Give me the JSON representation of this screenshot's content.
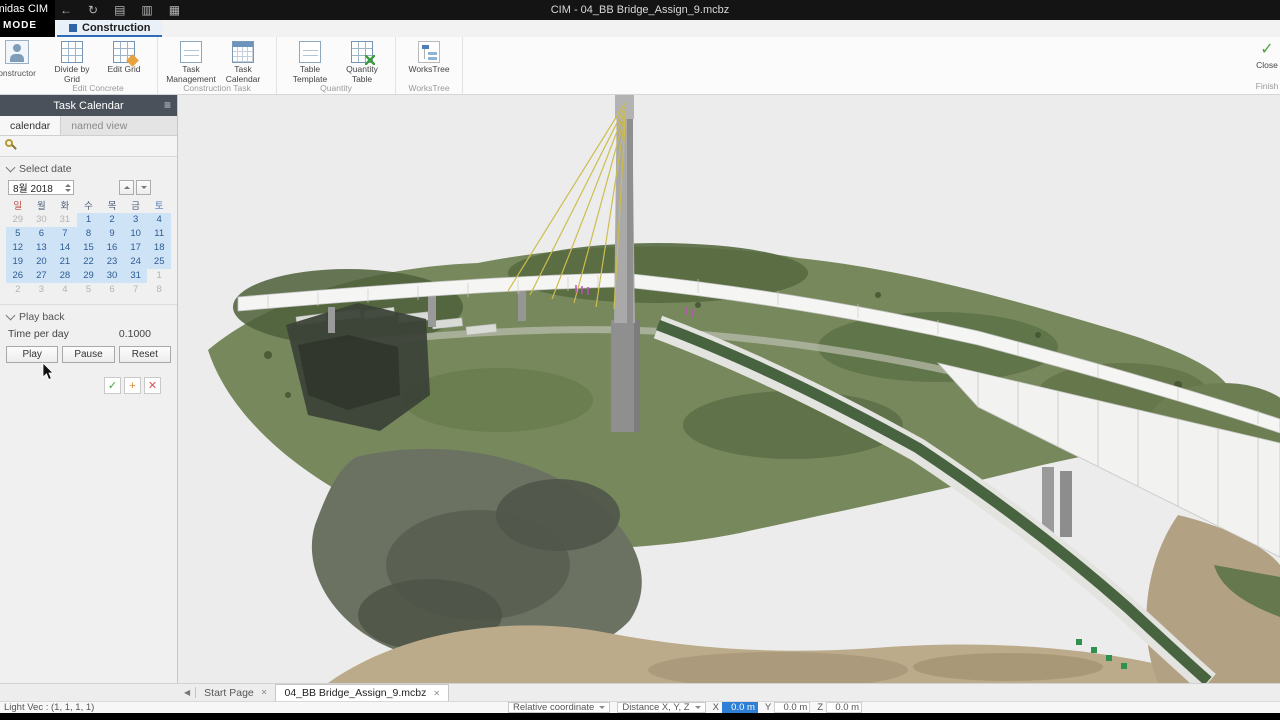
{
  "titlebar": {
    "title": "CIM - 04_BB Bridge_Assign_9.mcbz",
    "icons": [
      {
        "name": "back-icon",
        "glyph": "←"
      },
      {
        "name": "refresh-icon",
        "glyph": "↻"
      },
      {
        "name": "new-document-icon",
        "glyph": "▤"
      },
      {
        "name": "open-document-icon",
        "glyph": "▥"
      },
      {
        "name": "save-icon",
        "glyph": "▦"
      }
    ]
  },
  "brand": {
    "logo": "midas CIM",
    "mode": "MODE"
  },
  "ribbon": {
    "active_tab": "Construction",
    "constructor_label": "Constructor",
    "groups": [
      {
        "label": "Edit Concrete",
        "buttons": [
          {
            "label": "Divide by Grid"
          },
          {
            "label": "Edit Grid"
          }
        ]
      },
      {
        "label": "Construction Task",
        "buttons": [
          {
            "label": "Task Management"
          },
          {
            "label": "Task Calendar"
          }
        ]
      },
      {
        "label": "Quantity",
        "buttons": [
          {
            "label": "Table Template"
          },
          {
            "label": "Quantity Table"
          }
        ]
      },
      {
        "label": "WorksTree",
        "buttons": [
          {
            "label": "WorksTree"
          }
        ]
      }
    ],
    "close": {
      "label": "Close",
      "group": "Finish",
      "glyph": "✓"
    }
  },
  "panel": {
    "title": "Task Calendar",
    "menu_glyph": "≡",
    "tabs": [
      {
        "label": "calendar"
      },
      {
        "label": "named view"
      }
    ],
    "select_date": {
      "section": "Select date",
      "month": "8월 2018"
    },
    "calendar": {
      "weekdays": [
        "일",
        "월",
        "화",
        "수",
        "목",
        "금",
        "토"
      ],
      "rows": [
        {
          "cells": [
            {
              "n": "29",
              "s": "m"
            },
            {
              "n": "30",
              "s": "m"
            },
            {
              "n": "31",
              "s": "m"
            },
            {
              "n": "1",
              "s": "h"
            },
            {
              "n": "2",
              "s": "h"
            },
            {
              "n": "3",
              "s": "h"
            },
            {
              "n": "4",
              "s": "h"
            }
          ]
        },
        {
          "cells": [
            {
              "n": "5",
              "s": "h"
            },
            {
              "n": "6",
              "s": "h"
            },
            {
              "n": "7",
              "s": "h"
            },
            {
              "n": "8",
              "s": "h"
            },
            {
              "n": "9",
              "s": "h"
            },
            {
              "n": "10",
              "s": "h"
            },
            {
              "n": "11",
              "s": "h"
            }
          ]
        },
        {
          "cells": [
            {
              "n": "12",
              "s": "h"
            },
            {
              "n": "13",
              "s": "h"
            },
            {
              "n": "14",
              "s": "h"
            },
            {
              "n": "15",
              "s": "h"
            },
            {
              "n": "16",
              "s": "h"
            },
            {
              "n": "17",
              "s": "h"
            },
            {
              "n": "18",
              "s": "h"
            }
          ]
        },
        {
          "cells": [
            {
              "n": "19",
              "s": "h"
            },
            {
              "n": "20",
              "s": "h"
            },
            {
              "n": "21",
              "s": "h"
            },
            {
              "n": "22",
              "s": "h"
            },
            {
              "n": "23",
              "s": "h"
            },
            {
              "n": "24",
              "s": "h"
            },
            {
              "n": "25",
              "s": "h"
            }
          ]
        },
        {
          "cells": [
            {
              "n": "26",
              "s": "h"
            },
            {
              "n": "27",
              "s": "h"
            },
            {
              "n": "28",
              "s": "h"
            },
            {
              "n": "29",
              "s": "h"
            },
            {
              "n": "30",
              "s": "h"
            },
            {
              "n": "31",
              "s": "h"
            },
            {
              "n": "1",
              "s": "m"
            }
          ]
        },
        {
          "cells": [
            {
              "n": "2",
              "s": "m"
            },
            {
              "n": "3",
              "s": "m"
            },
            {
              "n": "4",
              "s": "m"
            },
            {
              "n": "5",
              "s": "m"
            },
            {
              "n": "6",
              "s": "m"
            },
            {
              "n": "7",
              "s": "m"
            },
            {
              "n": "8",
              "s": "m"
            }
          ]
        }
      ]
    },
    "playback": {
      "section": "Play back",
      "time_label": "Time per day",
      "time_value": "0.1000",
      "buttons": [
        "Play",
        "Pause",
        "Reset"
      ]
    },
    "actions": [
      {
        "name": "confirm-button",
        "glyph": "✓",
        "kind": "confirm"
      },
      {
        "name": "add-button",
        "glyph": "+",
        "kind": "add"
      },
      {
        "name": "delete-button",
        "glyph": "✕",
        "kind": "del"
      }
    ]
  },
  "doctabs": {
    "close_glyph": "✕",
    "tabs": [
      {
        "label": "Start Page",
        "active": false
      },
      {
        "label": "04_BB Bridge_Assign_9.mcbz",
        "active": true
      }
    ]
  },
  "statusbar": {
    "light_vec": "Light Vec : (1, 1, 1, 1)",
    "coordinate_dropdown": "Relative coordinate",
    "distance_dropdown": "Distance X, Y, Z",
    "fields": [
      {
        "label": "X",
        "value": "0.0 m",
        "selected": true
      },
      {
        "label": "Y",
        "value": "0.0 m",
        "selected": false
      },
      {
        "label": "Z",
        "value": "0.0 m",
        "selected": false
      }
    ]
  },
  "colors": {
    "accent_blue": "#2f6cb5",
    "calendar_highlight": "#cfe3f6",
    "selection_blue": "#2f7fd6",
    "cable_yellow": "#cdbd4e"
  }
}
